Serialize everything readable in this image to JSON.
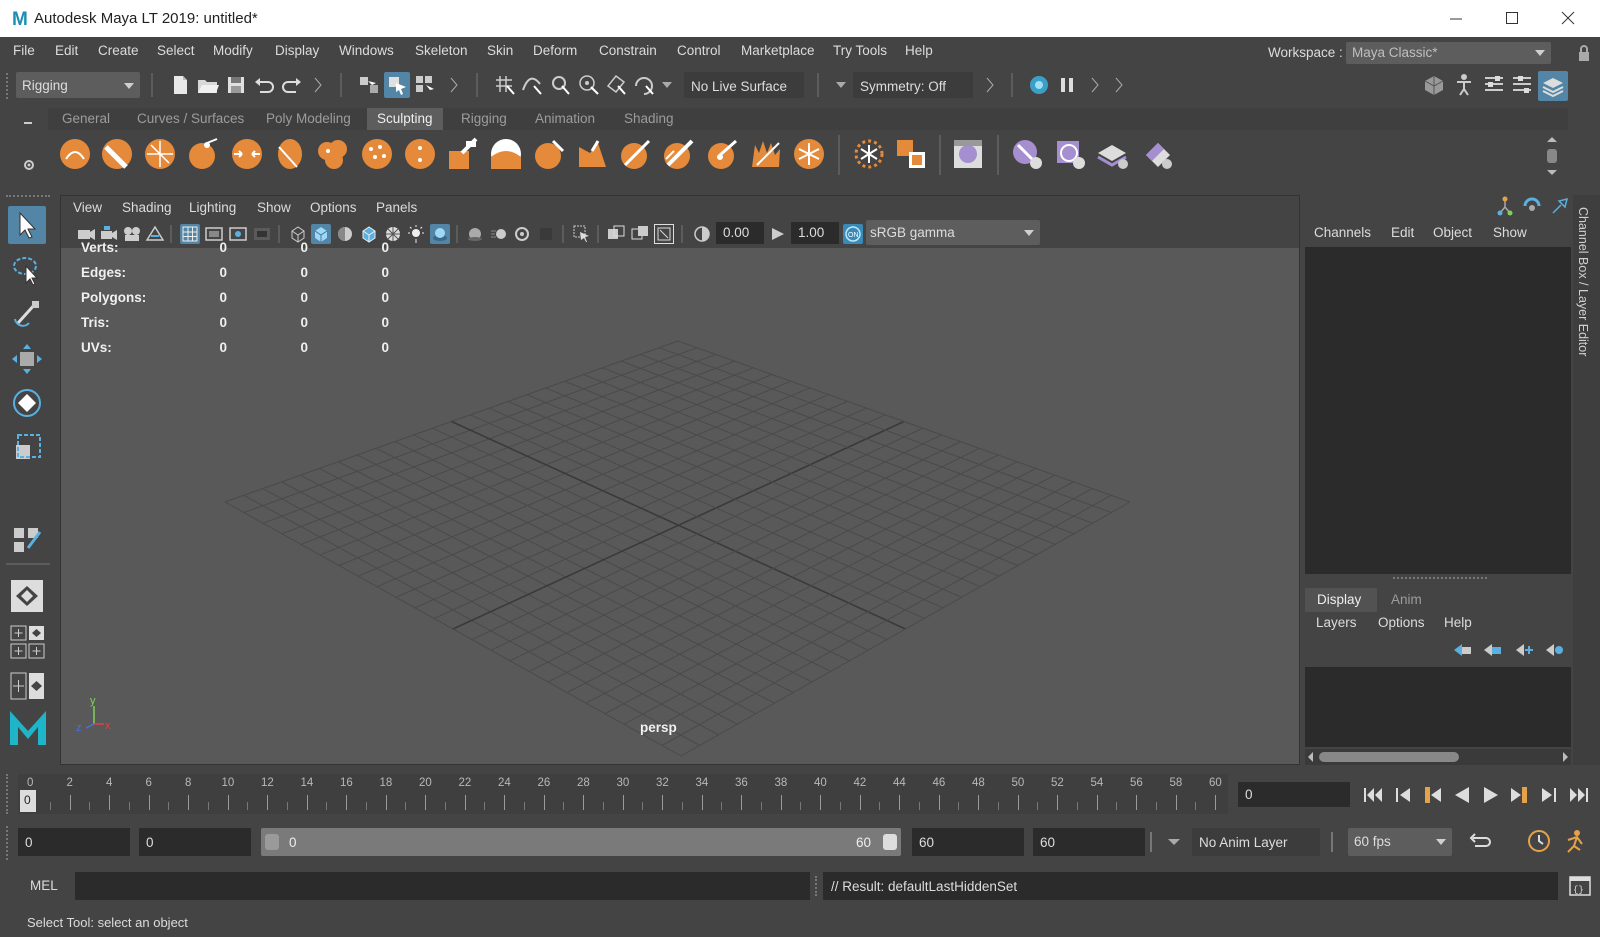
{
  "window": {
    "title": "Autodesk Maya LT 2019: untitled*",
    "app_logo_letter": "M",
    "controls": [
      "minimize-icon",
      "maximize-icon",
      "close-icon"
    ]
  },
  "menubar": {
    "items": [
      "File",
      "Edit",
      "Create",
      "Select",
      "Modify",
      "Display",
      "Windows",
      "Skeleton",
      "Skin",
      "Deform",
      "Constrain",
      "Control",
      "Marketplace",
      "Try Tools",
      "Help"
    ],
    "workspace_label": "Workspace :",
    "workspace_value": "Maya Classic*"
  },
  "statusline": {
    "menuset": "Rigging",
    "live_surface": "No Live Surface",
    "symmetry": "Symmetry: Off"
  },
  "shelf": {
    "tabs": [
      "General",
      "Curves / Surfaces",
      "Poly Modeling",
      "Sculpting",
      "Rigging",
      "Animation",
      "Shading"
    ],
    "active_tab": "Sculpting",
    "sculpt_color": "#e58a3a",
    "icons": [
      "sculpt-icon",
      "smooth-icon",
      "relax-icon",
      "grab-icon",
      "pinch-icon",
      "flatten-icon",
      "foamy-icon",
      "spray-icon",
      "repeat-icon",
      "imprint-icon",
      "wax-icon",
      "scrape-icon",
      "fill-icon",
      "knife-icon",
      "smear-icon",
      "bulge-icon",
      "amplify-icon",
      "freeze-icon",
      "convert-to-frozen-icon",
      "mask-icon",
      "sculpt-settings-icon",
      "mesh-icon",
      "stamp-icon",
      "stencil-icon",
      "eraser-icon"
    ]
  },
  "toolbox": {
    "tools": [
      "select-tool-icon",
      "lasso-tool-icon",
      "paint-select-icon",
      "move-tool-icon",
      "rotate-tool-icon",
      "scale-tool-icon",
      "show-manipulator-icon",
      "single-perspective-layout-icon",
      "four-view-layout-icon",
      "two-view-layout-icon"
    ]
  },
  "viewport": {
    "menu": [
      "View",
      "Shading",
      "Lighting",
      "Show",
      "Options",
      "Panels"
    ],
    "exposure": "0.00",
    "gamma": "1.00",
    "color_space": "sRGB gamma",
    "camera_label": "persp",
    "hud": {
      "rows": [
        {
          "label": "Verts:",
          "values": [
            "0",
            "0",
            "0"
          ]
        },
        {
          "label": "Edges:",
          "values": [
            "0",
            "0",
            "0"
          ]
        },
        {
          "label": "Polygons:",
          "values": [
            "0",
            "0",
            "0"
          ]
        },
        {
          "label": "Tris:",
          "values": [
            "0",
            "0",
            "0"
          ]
        },
        {
          "label": "UVs:",
          "values": [
            "0",
            "0",
            "0"
          ]
        }
      ]
    },
    "axis": {
      "x": "x",
      "y": "y",
      "z": "z"
    }
  },
  "channelbox": {
    "menu": [
      "Channels",
      "Edit",
      "Object",
      "Show"
    ],
    "layer_tabs": [
      "Display",
      "Anim"
    ],
    "layer_menu": [
      "Layers",
      "Options",
      "Help"
    ],
    "side_tab": "Channel Box / Layer Editor"
  },
  "timeslider": {
    "ticks": [
      "0",
      "2",
      "4",
      "6",
      "8",
      "10",
      "12",
      "14",
      "16",
      "18",
      "20",
      "22",
      "24",
      "26",
      "28",
      "30",
      "32",
      "34",
      "36",
      "38",
      "40",
      "42",
      "44",
      "46",
      "48",
      "50",
      "52",
      "54",
      "56",
      "58",
      "60"
    ],
    "current_frame_marker": "0",
    "current_frame": "0"
  },
  "rangeslider": {
    "start": "0",
    "playback_start": "0",
    "range_start": "0",
    "range_end": "60",
    "playback_end": "60",
    "end": "60",
    "anim_layer": "No Anim Layer",
    "fps": "60 fps"
  },
  "cmdline": {
    "language": "MEL",
    "result": "// Result: defaultLastHiddenSet"
  },
  "helpline": {
    "text": "Select Tool: select an object"
  },
  "colors": {
    "accent_blue": "#5285a6",
    "play_active": "#5aa4d6",
    "grid_line": "#4a4a4a",
    "grid_axis": "#3a3a3a"
  }
}
